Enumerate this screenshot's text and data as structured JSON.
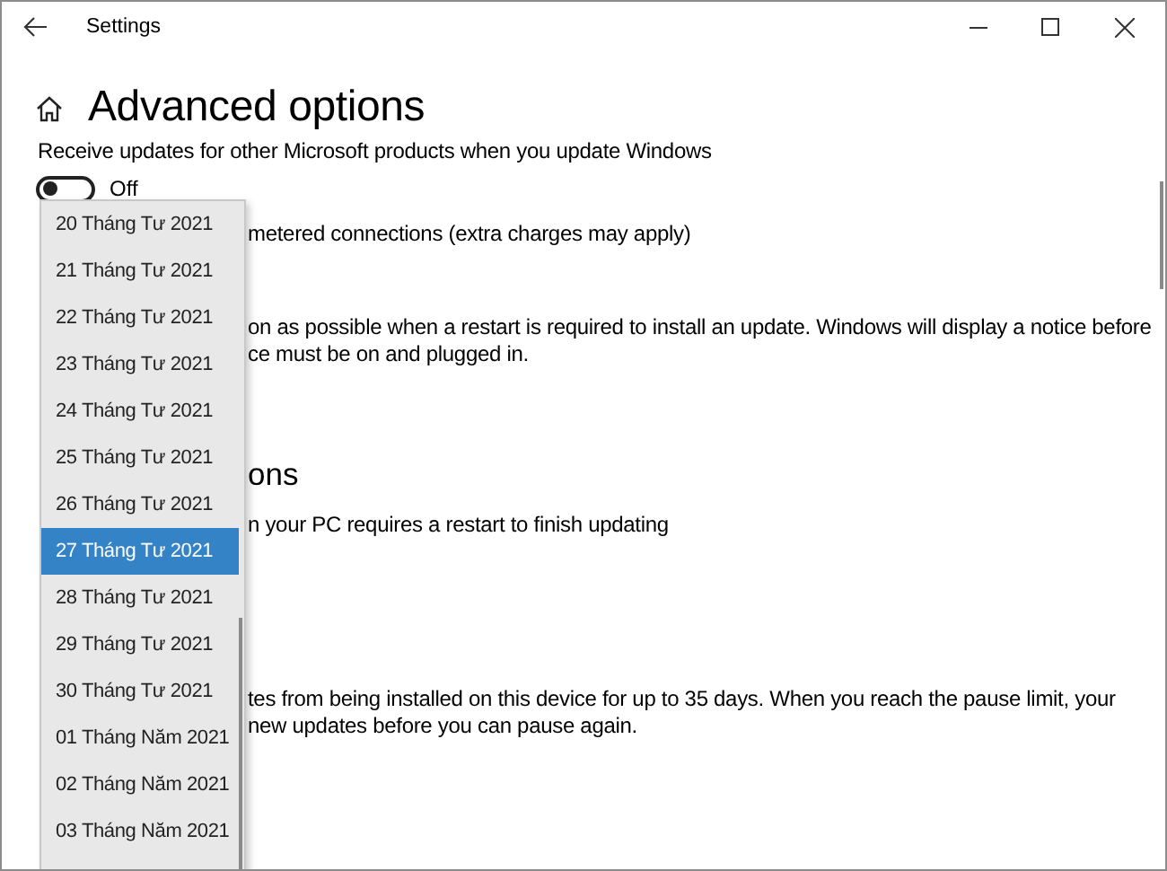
{
  "window": {
    "title": "Settings"
  },
  "page": {
    "title": "Advanced options"
  },
  "receive_updates": {
    "label": "Receive updates for other Microsoft products when you update Windows",
    "on": false,
    "state_text": "Off"
  },
  "metered_text": "metered connections (extra charges may apply)",
  "restart_text": [
    "on as possible when a restart is required to install an update. Windows will display a notice before",
    "ce must be on and plugged in."
  ],
  "notifications_heading": "ons",
  "notification_text": "n your PC requires a restart to finish updating",
  "pause_text": [
    "tes from being installed on this device for up to 35 days. When you reach the pause limit, your",
    "new updates before you can pause again."
  ],
  "date_dropdown": {
    "items": [
      {
        "label": "20 Tháng Tư 2021",
        "selected": false
      },
      {
        "label": "21 Tháng Tư 2021",
        "selected": false
      },
      {
        "label": "22 Tháng Tư 2021",
        "selected": false
      },
      {
        "label": "23 Tháng Tư 2021",
        "selected": false
      },
      {
        "label": "24 Tháng Tư 2021",
        "selected": false
      },
      {
        "label": "25 Tháng Tư 2021",
        "selected": false
      },
      {
        "label": "26 Tháng Tư 2021",
        "selected": false
      },
      {
        "label": "27 Tháng Tư 2021",
        "selected": true
      },
      {
        "label": "28 Tháng Tư 2021",
        "selected": false
      },
      {
        "label": "29 Tháng Tư 2021",
        "selected": false
      },
      {
        "label": "30 Tháng Tư 2021",
        "selected": false
      },
      {
        "label": "01 Tháng Năm 2021",
        "selected": false
      },
      {
        "label": "02 Tháng Năm 2021",
        "selected": false
      },
      {
        "label": "03 Tháng Năm 2021",
        "selected": false
      }
    ]
  }
}
